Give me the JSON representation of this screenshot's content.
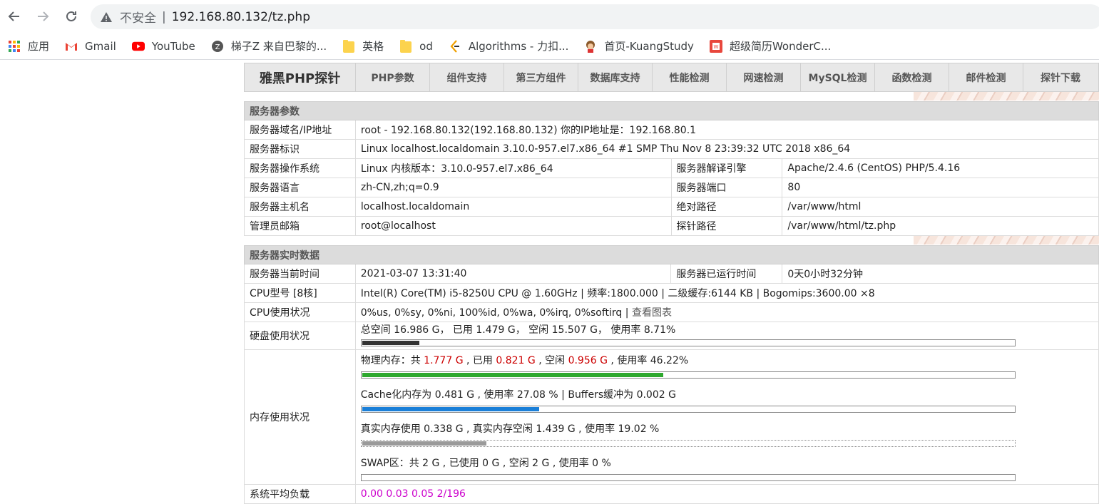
{
  "browser": {
    "insecure_label": "不安全",
    "separator": "|",
    "url": "192.168.80.132/tz.php"
  },
  "bookmarks": [
    {
      "label": "应用",
      "icon": "apps-grid-icon"
    },
    {
      "label": "Gmail",
      "icon": "gmail-icon"
    },
    {
      "label": "YouTube",
      "icon": "youtube-icon"
    },
    {
      "label": "梯子Z 来自巴黎的...",
      "icon": "ladder-z-icon"
    },
    {
      "label": "英格",
      "icon": "folder-icon"
    },
    {
      "label": "od",
      "icon": "folder-icon"
    },
    {
      "label": "Algorithms - 力扣...",
      "icon": "leetcode-icon"
    },
    {
      "label": "首页-KuangStudy",
      "icon": "kuangstudy-icon"
    },
    {
      "label": "超级简历WonderC...",
      "icon": "wondercv-icon"
    }
  ],
  "menu": {
    "brand": "雅黑PHP探针",
    "items": [
      "PHP参数",
      "组件支持",
      "第三方组件",
      "数据库支持",
      "性能检测",
      "网速检测",
      "MySQL检测",
      "函数检测",
      "邮件检测",
      "探针下载"
    ]
  },
  "server_params": {
    "title": "服务器参数",
    "domain_ip_label": "服务器域名/IP地址",
    "domain_ip_value": "root - 192.168.80.132(192.168.80.132)  你的IP地址是：192.168.80.1",
    "ident_label": "服务器标识",
    "ident_value": "Linux localhost.localdomain 3.10.0-957.el7.x86_64 #1 SMP Thu Nov 8 23:39:32 UTC 2018 x86_64",
    "os_label": "服务器操作系统",
    "os_value": "Linux  内核版本：3.10.0-957.el7.x86_64",
    "engine_label": "服务器解译引擎",
    "engine_value": "Apache/2.4.6 (CentOS) PHP/5.4.16",
    "lang_label": "服务器语言",
    "lang_value": "zh-CN,zh;q=0.9",
    "port_label": "服务器端口",
    "port_value": "80",
    "host_label": "服务器主机名",
    "host_value": "localhost.localdomain",
    "abs_path_label": "绝对路径",
    "abs_path_value": "/var/www/html",
    "admin_label": "管理员邮箱",
    "admin_value": "root@localhost",
    "probe_path_label": "探针路径",
    "probe_path_value": "/var/www/html/tz.php"
  },
  "realtime": {
    "title": "服务器实时数据",
    "time_label": "服务器当前时间",
    "time_value": "2021-03-07 13:31:40",
    "uptime_label": "服务器已运行时间",
    "uptime_value": "0天0小时32分钟",
    "cpu_model_label": "CPU型号 [8核]",
    "cpu_model_value": "Intel(R) Core(TM) i5-8250U CPU @ 1.60GHz | 频率:1800.000 | 二级缓存:6144 KB | Bogomips:3600.00 ×8",
    "cpu_usage_label": "CPU使用状况",
    "cpu_usage_value": "0%us, 0%sy, 0%ni, 100%id, 0%wa, 0%irq, 0%softirq",
    "cpu_usage_sep": " | ",
    "cpu_chart_link": "查看图表",
    "disk_label": "硬盘使用状况",
    "disk_text": "总空间 16.986 G，  已用 1.479 G，  空闲 15.507 G，  使用率 8.71%",
    "disk_usage_pct": 8.71,
    "disk_bar_color": "#333333",
    "memory_label": "内存使用状况",
    "mem_phys_prefix": "物理内存：共 ",
    "mem_phys_total": "1.777 G",
    "mem_phys_used_prefix": " , 已用 ",
    "mem_phys_used": "0.821 G",
    "mem_phys_free_prefix": " , 空闲 ",
    "mem_phys_free": "0.956 G",
    "mem_phys_rate": " , 使用率 46.22%",
    "mem_phys_pct": 46.22,
    "mem_phys_color": "#2ea82e",
    "mem_cache_text": "Cache化内存为 0.481 G , 使用率 27.08 % | Buffers缓冲为 0.002 G",
    "mem_cache_pct": 27.08,
    "mem_cache_color": "#1a7fd8",
    "mem_real_text": "真实内存使用 0.338 G , 真实内存空闲 1.439 G , 使用率 19.02 %",
    "mem_real_pct": 19.02,
    "mem_real_color": "#9a9a9a",
    "mem_swap_text": "SWAP区：共 2 G , 已使用 0 G , 空闲 2 G , 使用率 0 %",
    "mem_swap_pct": 0,
    "load_label": "系统平均负载",
    "load_value": "0.00 0.03 0.05 2/196"
  }
}
